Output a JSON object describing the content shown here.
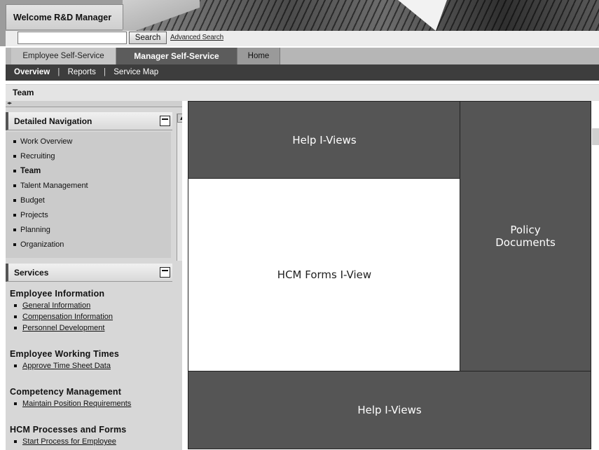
{
  "header": {
    "welcome": "Welcome R&D Manager",
    "search_value": "",
    "search_button": "Search",
    "advanced_search": "Advanced Search"
  },
  "tabs": [
    {
      "label": "Employee Self-Service",
      "selected": false
    },
    {
      "label": "Manager Self-Service",
      "selected": true
    },
    {
      "label": "Home",
      "selected": false
    }
  ],
  "subnav": [
    {
      "label": "Overview",
      "active": true
    },
    {
      "label": "Reports",
      "active": false
    },
    {
      "label": "Service Map",
      "active": false
    }
  ],
  "page_title": "Team",
  "left": {
    "detailed_navigation": {
      "title": "Detailed Navigation",
      "items": [
        {
          "label": "Work Overview"
        },
        {
          "label": "Recruiting"
        },
        {
          "label": "Team",
          "current": true
        },
        {
          "label": "Talent Management"
        },
        {
          "label": "Budget"
        },
        {
          "label": "Projects"
        },
        {
          "label": "Planning"
        },
        {
          "label": "Organization"
        }
      ]
    },
    "services": {
      "title": "Services",
      "groups": [
        {
          "title": "Employee Information",
          "links": [
            "General Information",
            "Compensation Information",
            "Personnel Development"
          ]
        },
        {
          "title": "Employee Working Times",
          "links": [
            "Approve Time Sheet Data"
          ]
        },
        {
          "title": "Competency Management",
          "links": [
            "Maintain Position Requirements"
          ]
        },
        {
          "title": "HCM Processes and Forms",
          "links": [
            "Start Process for Employee"
          ]
        }
      ]
    }
  },
  "content": {
    "help_top": "Help I-Views",
    "hcm_forms": "HCM Forms I-View",
    "policy_line1": "Policy",
    "policy_line2": "Documents",
    "help_bottom": "Help I-Views"
  },
  "colors": {
    "dark_block": "#555555",
    "tab_selected": "#5c5c5c",
    "subnav_bg": "#3d3d3d",
    "panel_bg": "#d7d7d7"
  }
}
